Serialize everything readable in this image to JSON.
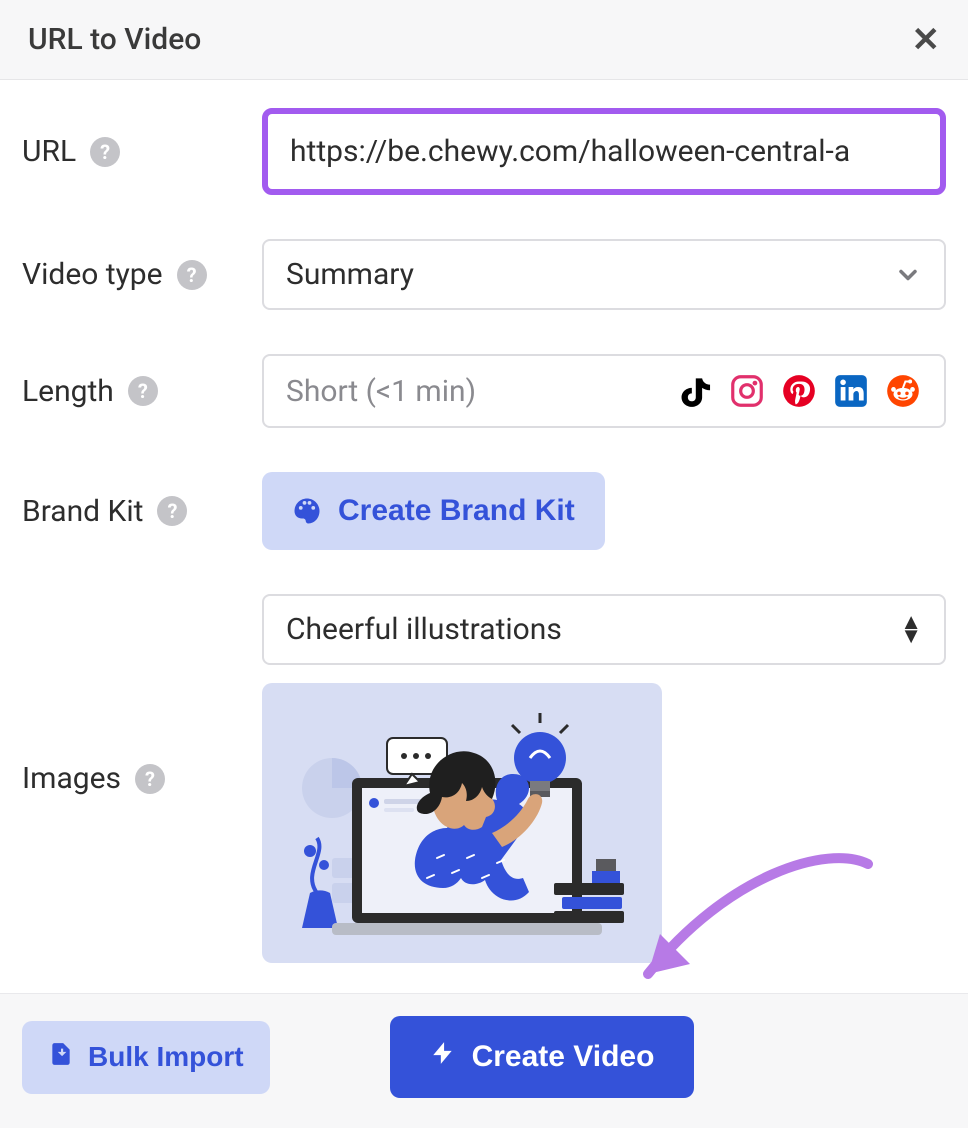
{
  "header": {
    "title": "URL to Video"
  },
  "form": {
    "url": {
      "label": "URL",
      "value": "https://be.chewy.com/halloween-central-a"
    },
    "video_type": {
      "label": "Video type",
      "value": "Summary"
    },
    "length": {
      "label": "Length",
      "placeholder": "Short (<1 min)"
    },
    "brand_kit": {
      "label": "Brand Kit",
      "button_label": "Create Brand Kit"
    },
    "images": {
      "label": "Images",
      "value": "Cheerful illustrations"
    }
  },
  "footer": {
    "bulk_import_label": "Bulk Import",
    "create_video_label": "Create Video"
  }
}
